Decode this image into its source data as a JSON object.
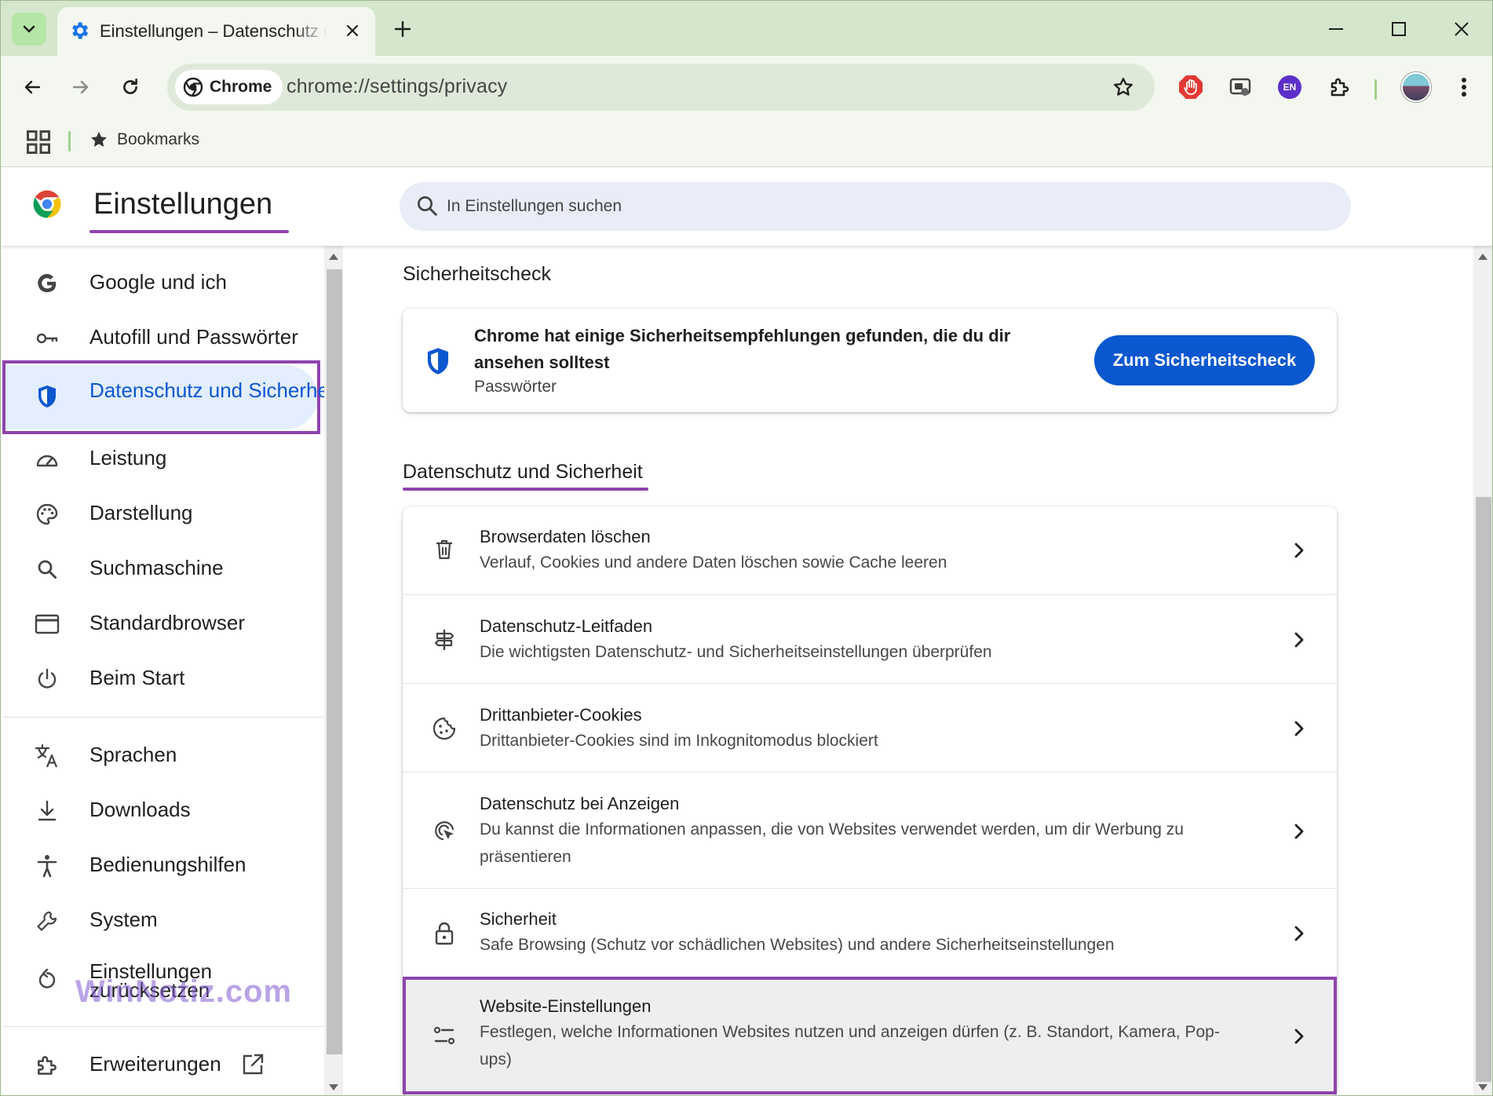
{
  "browser": {
    "tab_title": "Einstellungen – Datenschutz und Sicherheit",
    "omnibox_chip": "Chrome",
    "url": "chrome://settings/privacy",
    "ext_badge_en": "EN",
    "bookmarks_label": "Bookmarks",
    "accent": "#d4e6cc"
  },
  "header": {
    "title": "Einstellungen",
    "search_placeholder": "In Einstellungen suchen"
  },
  "sidebar": {
    "items": [
      {
        "label": "Google und ich",
        "icon": "google-g-icon"
      },
      {
        "label": "Autofill und Passwörter",
        "icon": "key-icon"
      },
      {
        "label": "Datenschutz und Sicherheit",
        "icon": "shield-icon",
        "active": true
      },
      {
        "label": "Leistung",
        "icon": "speedometer-icon"
      },
      {
        "label": "Darstellung",
        "icon": "palette-icon"
      },
      {
        "label": "Suchmaschine",
        "icon": "search-icon"
      },
      {
        "label": "Standardbrowser",
        "icon": "browser-window-icon"
      },
      {
        "label": "Beim Start",
        "icon": "power-icon"
      },
      {
        "label": "Sprachen",
        "icon": "translate-icon"
      },
      {
        "label": "Downloads",
        "icon": "download-icon"
      },
      {
        "label": "Bedienungshilfen",
        "icon": "accessibility-icon"
      },
      {
        "label": "System",
        "icon": "wrench-icon"
      },
      {
        "label": "Einstellungen zurücksetzen",
        "icon": "reset-icon"
      },
      {
        "label": "Erweiterungen",
        "icon": "puzzle-icon"
      }
    ],
    "watermark": "WinNotiz.com"
  },
  "safety_check": {
    "section_title": "Sicherheitscheck",
    "message": "Chrome hat einige Sicherheitsempfehlungen gefunden, die du dir ansehen solltest",
    "sub": "Passwörter",
    "button": "Zum Sicherheitscheck"
  },
  "privacy": {
    "section_title": "Datenschutz und Sicherheit",
    "rows": [
      {
        "title": "Browserdaten löschen",
        "sub": "Verlauf, Cookies und andere Daten löschen sowie Cache leeren",
        "icon": "trash-icon"
      },
      {
        "title": "Datenschutz-Leitfaden",
        "sub": "Die wichtigsten Datenschutz- und Sicherheitseinstellungen überprüfen",
        "icon": "signpost-icon"
      },
      {
        "title": "Drittanbieter-Cookies",
        "sub": "Drittanbieter-Cookies sind im Inkognitomodus blockiert",
        "icon": "cookie-icon"
      },
      {
        "title": "Datenschutz bei Anzeigen",
        "sub": "Du kannst die Informationen anpassen, die von Websites verwendet werden, um dir Werbung zu präsentieren",
        "icon": "ad-privacy-icon"
      },
      {
        "title": "Sicherheit",
        "sub": "Safe Browsing (Schutz vor schädlichen Websites) und andere Sicherheitseinstellungen",
        "icon": "lock-icon"
      },
      {
        "title": "Website-Einstellungen",
        "sub": "Festlegen, welche Informationen Websites nutzen und anzeigen dürfen (z. B. Standort, Kamera, Pop-ups)",
        "icon": "tune-icon"
      }
    ]
  },
  "colors": {
    "highlight": "#8e44ad",
    "primary_blue": "#0b57d0",
    "active_bg": "#e3eefe"
  }
}
